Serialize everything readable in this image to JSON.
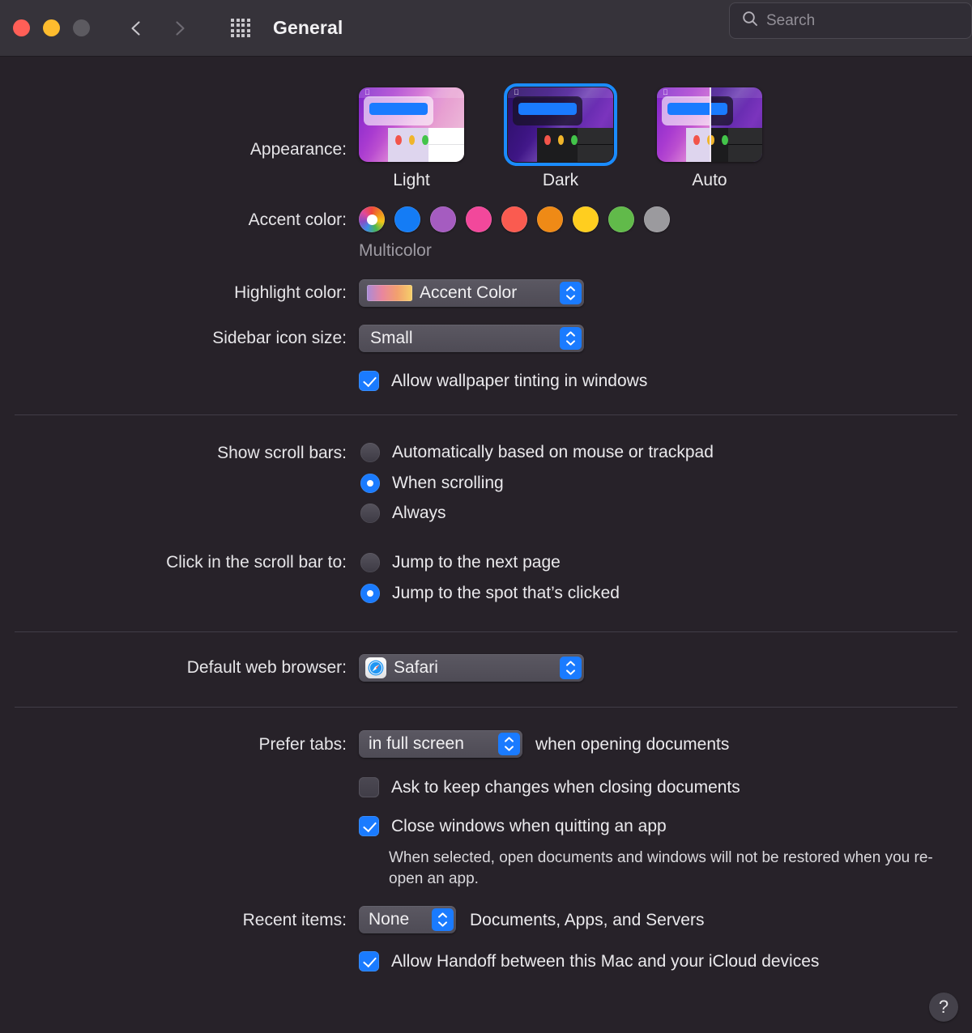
{
  "window": {
    "title": "General",
    "traffic_lights": [
      "close",
      "minimize",
      "zoom"
    ],
    "back_label": "Back",
    "forward_label": "Forward",
    "show_all_label": "Show All"
  },
  "search": {
    "placeholder": "Search",
    "value": ""
  },
  "appearance": {
    "label": "Appearance:",
    "options": [
      {
        "id": "light",
        "caption": "Light",
        "selected": false
      },
      {
        "id": "dark",
        "caption": "Dark",
        "selected": true
      },
      {
        "id": "auto",
        "caption": "Auto",
        "selected": false
      }
    ]
  },
  "accent_color": {
    "label": "Accent color:",
    "selected_name": "Multicolor",
    "swatches": [
      {
        "name": "multicolor",
        "hex": "multicolor",
        "selected": true
      },
      {
        "name": "blue",
        "hex": "#147cf5",
        "selected": false
      },
      {
        "name": "purple",
        "hex": "#a martin",
        "selected": false
      },
      {
        "name": "pink",
        "hex": "#f2489b",
        "selected": false
      },
      {
        "name": "red",
        "hex": "#fa5b50",
        "selected": false
      },
      {
        "name": "orange",
        "hex": "#ef8a16",
        "selected": false
      },
      {
        "name": "yellow",
        "hex": "#ffce1f",
        "selected": false
      },
      {
        "name": "green",
        "hex": "#61ba4a",
        "selected": false
      },
      {
        "name": "graphite",
        "hex": "#9b9a9e",
        "selected": false
      }
    ]
  },
  "highlight_color": {
    "label": "Highlight color:",
    "value": "Accent Color",
    "has_gradient_swatch": true
  },
  "sidebar_icon_size": {
    "label": "Sidebar icon size:",
    "value": "Small"
  },
  "wallpaper_tinting": {
    "label": "Allow wallpaper tinting in windows",
    "checked": true
  },
  "show_scroll_bars": {
    "label": "Show scroll bars:",
    "options": [
      {
        "label": "Automatically based on mouse or trackpad",
        "selected": false
      },
      {
        "label": "When scrolling",
        "selected": true
      },
      {
        "label": "Always",
        "selected": false
      }
    ]
  },
  "click_scroll_bar": {
    "label": "Click in the scroll bar to:",
    "options": [
      {
        "label": "Jump to the next page",
        "selected": false
      },
      {
        "label": "Jump to the spot that’s clicked",
        "selected": true
      }
    ]
  },
  "default_web_browser": {
    "label": "Default web browser:",
    "value": "Safari",
    "icon": "safari-compass-icon"
  },
  "prefer_tabs": {
    "label": "Prefer tabs:",
    "value": "in full screen",
    "suffix": "when opening documents"
  },
  "ask_keep_changes": {
    "label": "Ask to keep changes when closing documents",
    "checked": false
  },
  "close_windows_quitting": {
    "label": "Close windows when quitting an app",
    "checked": true,
    "help_text": "When selected, open documents and windows will not be restored when you re-open an app."
  },
  "recent_items": {
    "label": "Recent items:",
    "value": "None",
    "suffix": "Documents, Apps, and Servers"
  },
  "handoff": {
    "label": "Allow Handoff between this Mac and your iCloud devices",
    "checked": true
  },
  "help_button": {
    "glyph": "?"
  },
  "colors": {
    "background": "#272229",
    "titlebar": "#36333a",
    "accent_blue": "#1a7bff",
    "separator": "#413d47",
    "text_primary": "#e9e8ea",
    "text_secondary": "#9e9ba3"
  }
}
